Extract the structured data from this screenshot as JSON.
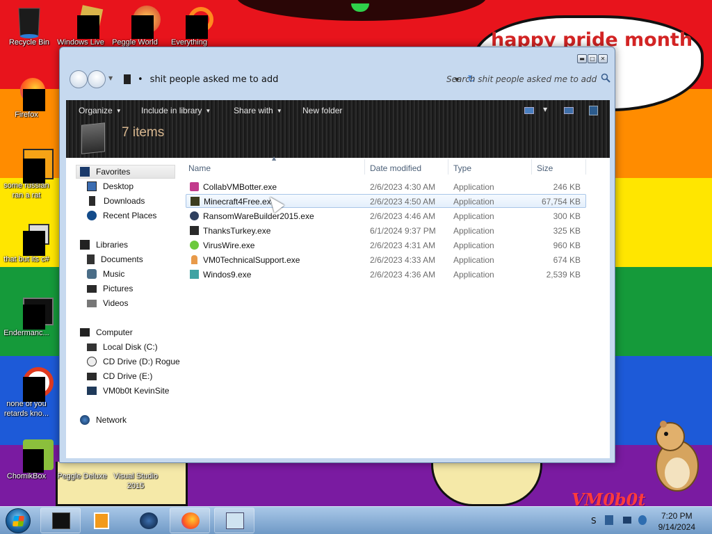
{
  "wallpaper": {
    "bands": [
      "#e8141c",
      "#ff8c00",
      "#ffe600",
      "#159a3a",
      "#1d5ad8",
      "#7a1ba1"
    ],
    "speech_text": "happy pride month",
    "logo_text": "VM0b0t"
  },
  "desktop_icons": [
    {
      "label": "Recycle Bin",
      "icon": "recycle-bin-icon"
    },
    {
      "label": "Windows Live",
      "icon": "windows-live-icon"
    },
    {
      "label": "Peggle World",
      "icon": "peggle-world-icon"
    },
    {
      "label": "Everything",
      "icon": "everything-icon"
    },
    {
      "label": "Firefox",
      "icon": "firefox-icon"
    },
    {
      "label": "some russian",
      "label2": "ran a rat",
      "icon": "rat-program-icon"
    },
    {
      "label": "that but its c#",
      "icon": "stacked-windows-icon"
    },
    {
      "label": "Endermanc...",
      "icon": "endermanch-icon"
    },
    {
      "label": "none of you",
      "label2": "retards kno...",
      "icon": "red-logo-icon"
    },
    {
      "label": "ChomikBox",
      "icon": "chomikbox-icon"
    },
    {
      "label": "Peggle Deluxe",
      "icon": "peggle-deluxe-icon"
    },
    {
      "label": "Visual Studio",
      "label2": "2015",
      "icon": "visual-studio-icon"
    }
  ],
  "window": {
    "address_path": "shit people asked me to add",
    "search_placeholder": "Search shit people asked me to add",
    "toolbar": {
      "organize": "Organize",
      "include_in_library": "Include in library",
      "share_with": "Share with",
      "new_folder": "New folder"
    },
    "items_count": "7 items",
    "nav": {
      "favorites": "Favorites",
      "desktop": "Desktop",
      "downloads": "Downloads",
      "recent_places": "Recent Places",
      "libraries": "Libraries",
      "documents": "Documents",
      "music": "Music",
      "pictures": "Pictures",
      "videos": "Videos",
      "computer": "Computer",
      "local_disk": "Local Disk (C:)",
      "cd_drive_d": "CD Drive (D:) Rogue",
      "cd_drive_e": "CD Drive (E:)",
      "vm0b0t_site": "VM0b0t KevinSite",
      "network": "Network"
    },
    "columns": {
      "name": "Name",
      "date_modified": "Date modified",
      "type": "Type",
      "size": "Size"
    },
    "files": [
      {
        "name": "CollabVMBotter.exe",
        "date": "2/6/2023 4:30 AM",
        "type": "Application",
        "size": "246 KB",
        "selected": false
      },
      {
        "name": "Minecraft4Free.exe",
        "date": "2/6/2023 4:50 AM",
        "type": "Application",
        "size": "67,754 KB",
        "selected": true
      },
      {
        "name": "RansomWareBuilder2015.exe",
        "date": "2/6/2023 4:46 AM",
        "type": "Application",
        "size": "300 KB",
        "selected": false
      },
      {
        "name": "ThanksTurkey.exe",
        "date": "6/1/2024 9:37 PM",
        "type": "Application",
        "size": "325 KB",
        "selected": false
      },
      {
        "name": "VirusWire.exe",
        "date": "2/6/2023 4:31 AM",
        "type": "Application",
        "size": "960 KB",
        "selected": false
      },
      {
        "name": "VM0TechnicalSupport.exe",
        "date": "2/6/2023 4:33 AM",
        "type": "Application",
        "size": "674 KB",
        "selected": false
      },
      {
        "name": "Windos9.exe",
        "date": "2/6/2023 4:36 AM",
        "type": "Application",
        "size": "2,539 KB",
        "selected": false
      }
    ]
  },
  "taskbar": {
    "time": "7:20 PM",
    "date": "9/14/2024",
    "tray_letter": "S",
    "buttons": [
      "cmd-icon",
      "media-player-icon",
      "globe-icon",
      "firefox-icon",
      "notepad-icon"
    ]
  }
}
